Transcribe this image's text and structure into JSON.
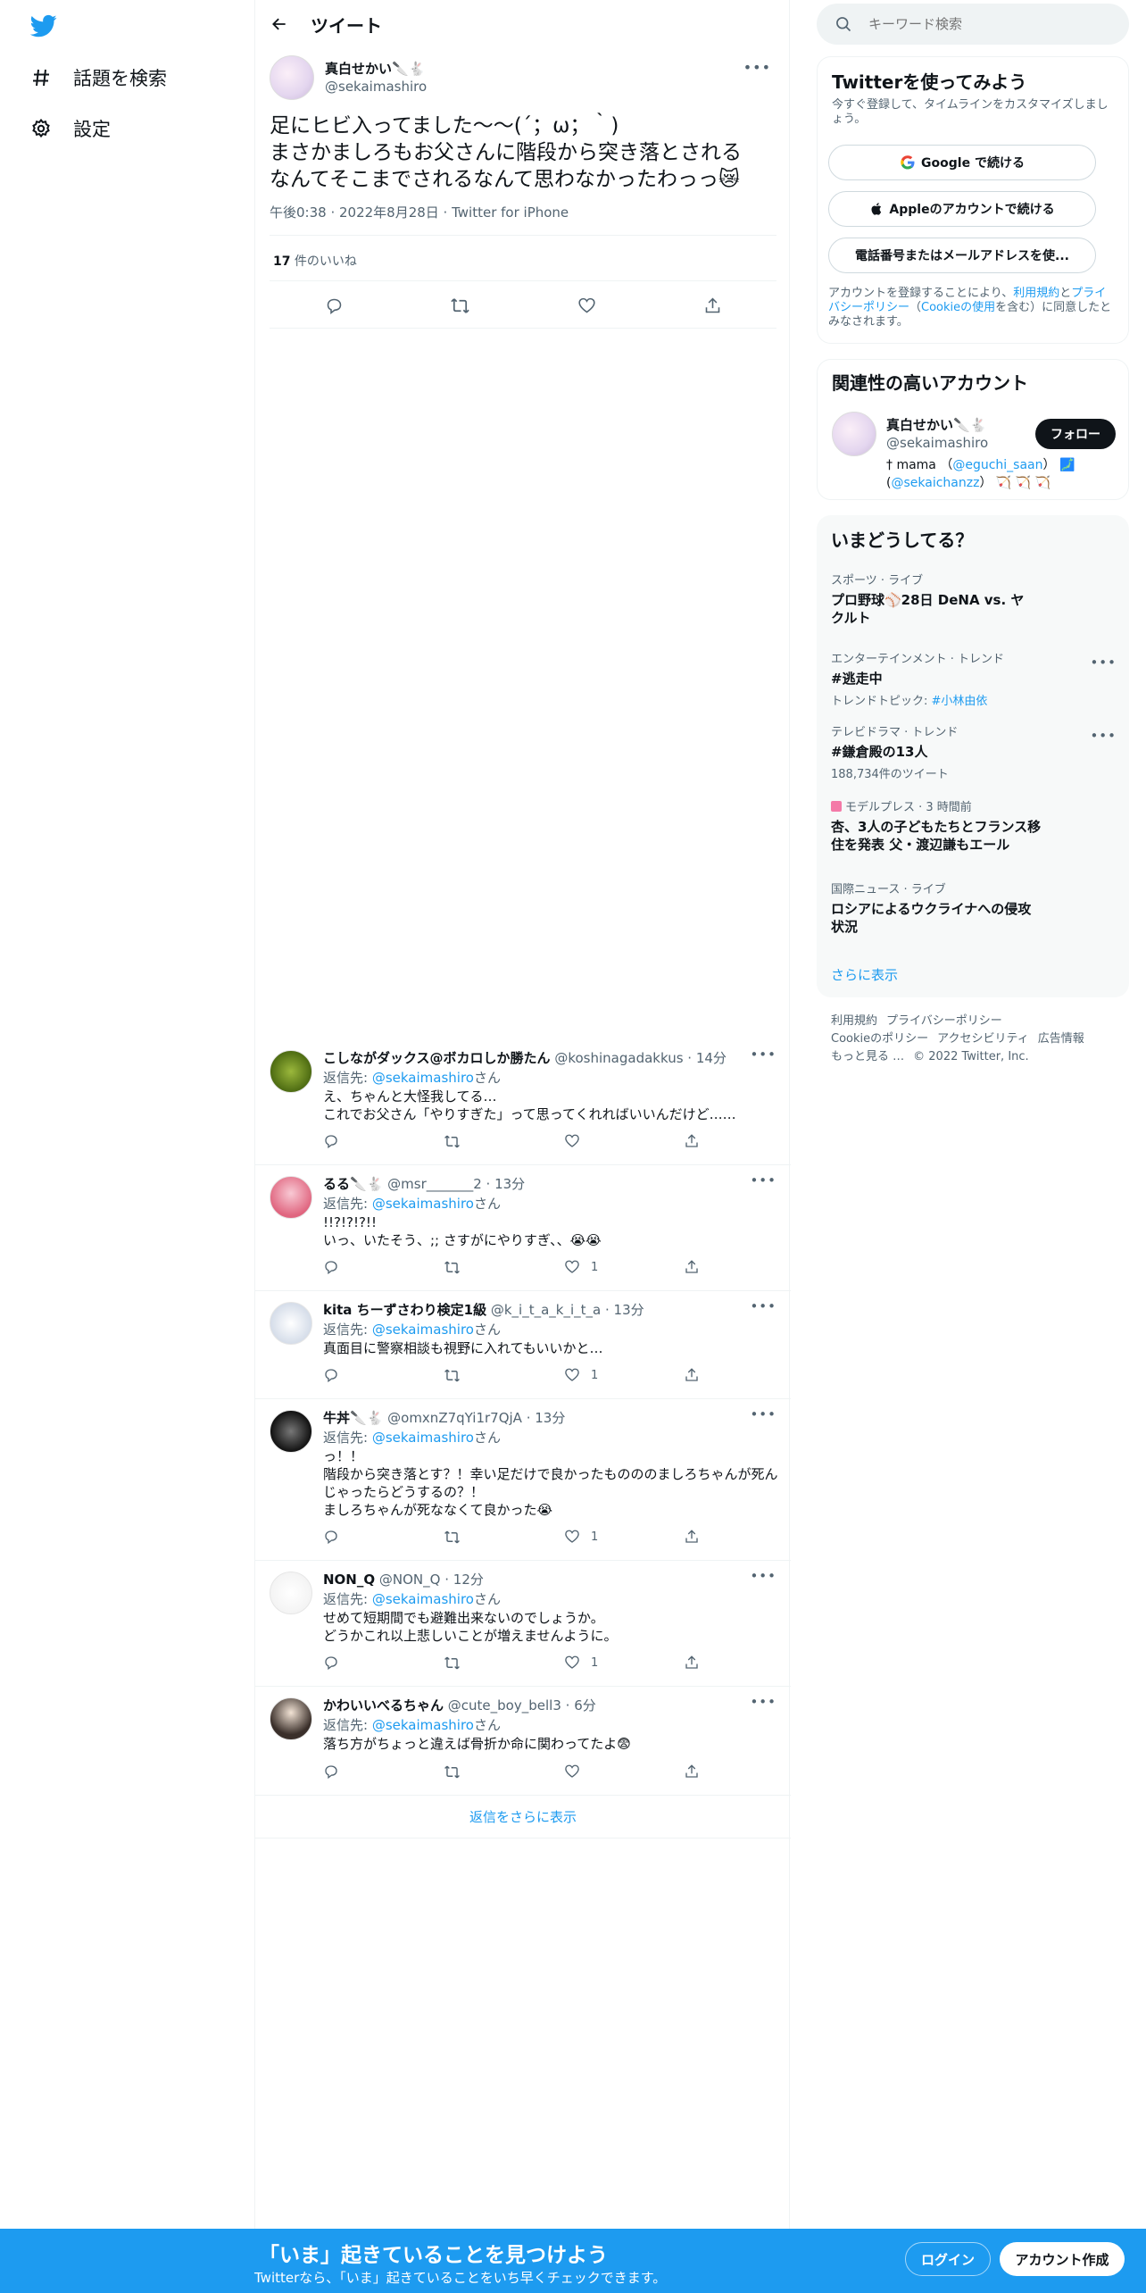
{
  "nav": {
    "explore_label": "話題を検索",
    "settings_label": "設定"
  },
  "header": {
    "title": "ツイート"
  },
  "tweet": {
    "name": "真白せかい🔪🐇",
    "handle": "@sekaimashiro",
    "text": "足にヒビ入ってました〜〜(´；ω；｀)\nまさかましろもお父さんに階段から突き落とされる\nなんてそこまでされるなんて思わなかったわっっ😿",
    "meta": "午後0:38 · 2022年8月28日 · Twitter for iPhone",
    "likes_count": "17",
    "likes_label": " 件のいいね"
  },
  "reply_prefix": "返信先: ",
  "reply_suffix": "さん",
  "reply_mention": "@sekaimashiro",
  "replies": [
    {
      "name": "こしながダックス@ボカロしか勝たん",
      "handle": "@koshinagadakkus",
      "time": "14分",
      "text": "え、ちゃんと大怪我してる…\nこれでお父さん「やりすぎた」って思ってくれればいいんだけど……",
      "likes": ""
    },
    {
      "name": "るる🔪🐇",
      "handle": "@msr_______2",
      "time": "13分",
      "text": "!!?!?!?!!\nいっ、いたそう、;; さすがにやりすぎ、、😭😭",
      "likes": "1"
    },
    {
      "name": "kita ちーずさわり検定1級",
      "handle": "@k_i_t_a_k_i_t_a",
      "time": "13分",
      "text": "真面目に警察相談も視野に入れてもいいかと…",
      "likes": "1"
    },
    {
      "name": "牛丼🔪🐇",
      "handle": "@omxnZ7qYi1r7QjA",
      "time": "13分",
      "text": "っ！！\n階段から突き落とす？！幸い足だけで良かったものののましろちゃんが死ん\nじゃったらどうするの？！\nましろちゃんが死ななくて良かった😭",
      "likes": "1"
    },
    {
      "name": "NON_Q",
      "handle": "@NON_Q",
      "time": "12分",
      "text": "せめて短期間でも避難出来ないのでしょうか。\nどうかこれ以上悲しいことが増えませんように。",
      "likes": "1"
    },
    {
      "name": "かわいいべるちゃん",
      "handle": "@cute_boy_bell3",
      "time": "6分",
      "text": "落ち方がちょっと違えば骨折か命に関わってたよ😨",
      "likes": ""
    }
  ],
  "show_more_replies": "返信をさらに表示",
  "search": {
    "placeholder": "キーワード検索"
  },
  "signup_card": {
    "title": "Twitterを使ってみよう",
    "subtitle": "今すぐ登録して、タイムラインをカスタマイズしましょう。",
    "google_label": "Google で続ける",
    "apple_label": "Appleのアカウントで続ける",
    "phone_label": "電話番号またはメールアドレスを使...",
    "legal_1": "アカウントを登録することにより、",
    "legal_terms": "利用規約",
    "legal_2": "と",
    "legal_privacy": "プライバシーポリシー",
    "legal_3": "（",
    "legal_cookie": "Cookieの使用",
    "legal_4": "を含む）に同意したとみなされます。"
  },
  "related": {
    "title": "関連性の高いアカウント",
    "name": "真白せかい🔪🐇",
    "handle": "@sekaimashiro",
    "follow_label": "フォロー",
    "bio_1": "† mama （",
    "bio_mention_1": "@eguchi_saan",
    "bio_2": "） 🗾(",
    "bio_mention_2": "@sekaichanzz",
    "bio_3": "） 🏹 🏹 🏹"
  },
  "trends": {
    "title": "いまどうしてる？",
    "items": [
      {
        "context": "スポーツ · ライブ",
        "title": "プロ野球⚾28日 DeNA vs. ヤクルト",
        "sub": ""
      },
      {
        "context": "エンターテインメント · トレンド",
        "title": "#逃走中",
        "sub_label": "トレンドトピック: ",
        "sub_hl": "#小林由依"
      },
      {
        "context": "テレビドラマ · トレンド",
        "title": "#鎌倉殿の13人",
        "sub": "188,734件のツイート"
      },
      {
        "context": "モデルプレス · 3 時間前",
        "title": "杏、3人の子どもたちとフランス移住を発表 父・渡辺謙もエール",
        "sub": ""
      },
      {
        "context": "国際ニュース · ライブ",
        "title": "ロシアによるウクライナへの侵攻状況",
        "sub": ""
      }
    ],
    "show_more": "さらに表示"
  },
  "footer": {
    "terms": "利用規約",
    "privacy": "プライバシーポリシー",
    "cookie": "Cookieのポリシー",
    "accessibility": "アクセシビリティ",
    "ads": "広告情報",
    "more": "もっと見る …",
    "copyright": "© 2022 Twitter, Inc."
  },
  "bottom_bar": {
    "title": "「いま」起きていることを見つけよう",
    "subtitle": "Twitterなら、「いま」起きていることをいち早くチェックできます。",
    "login_label": "ログイン",
    "signup_label": "アカウント作成"
  },
  "colors": {
    "accent": "#1d9bf0",
    "text": "#0f1419",
    "muted": "#536471"
  }
}
